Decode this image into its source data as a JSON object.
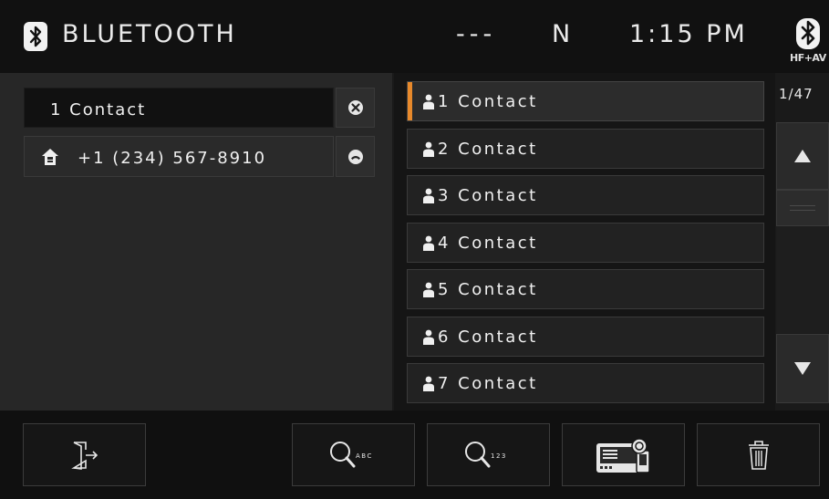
{
  "header": {
    "title": "BLUETOOTH",
    "signal": "---",
    "direction": "N",
    "time": "1:15 PM",
    "hf_label": "HF+AV"
  },
  "selected_contact": {
    "name": "1 Contact",
    "phone": "+1 (234) 567-8910"
  },
  "contacts": [
    {
      "label": "1 Contact"
    },
    {
      "label": "2 Contact"
    },
    {
      "label": "3 Contact"
    },
    {
      "label": "4 Contact"
    },
    {
      "label": "5 Contact"
    },
    {
      "label": "6 Contact"
    },
    {
      "label": "7 Contact"
    }
  ],
  "scroll": {
    "page_indicator": "1/47"
  },
  "colors": {
    "accent": "#e8892b",
    "background": "#1a1a1a",
    "header": "#111111"
  },
  "footer": {
    "buttons": [
      {
        "icon": "exit-icon"
      },
      {
        "icon": "search-abc-icon",
        "sub": "ABC"
      },
      {
        "icon": "search-123-icon",
        "sub": "123"
      },
      {
        "icon": "phonebook-sync-icon"
      },
      {
        "icon": "trash-icon"
      }
    ]
  }
}
